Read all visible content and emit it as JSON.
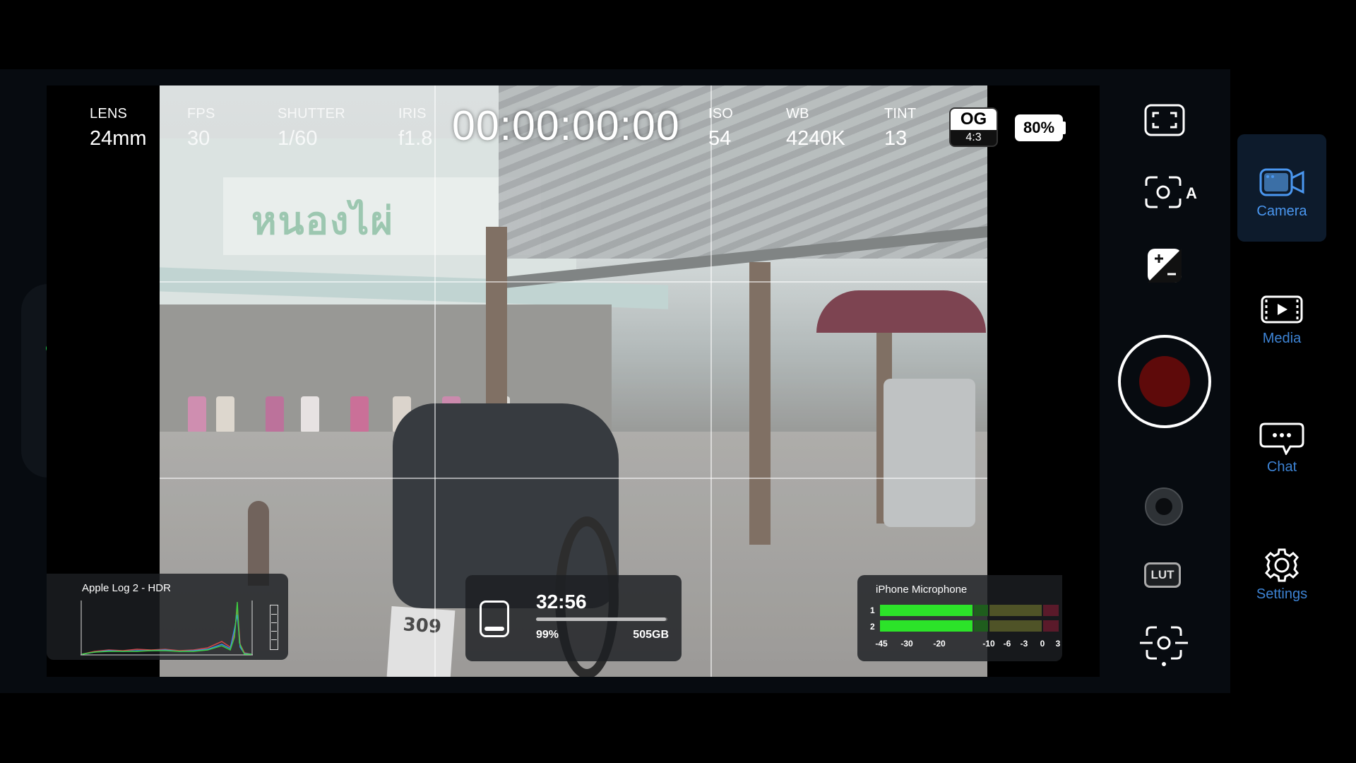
{
  "header": {
    "lens": {
      "label": "LENS",
      "value": "24mm"
    },
    "fps": {
      "label": "FPS",
      "value": "30"
    },
    "shutter": {
      "label": "SHUTTER",
      "value": "1/60"
    },
    "iris": {
      "label": "IRIS",
      "value": "f1.8"
    },
    "timecode": "00:00:00:00",
    "iso": {
      "label": "ISO",
      "value": "54"
    },
    "wb": {
      "label": "WB",
      "value": "4240K"
    },
    "tint": {
      "label": "TINT",
      "value": "13"
    },
    "aspect": {
      "format": "OG",
      "ratio": "4:3"
    },
    "battery": "80%"
  },
  "viewfinder": {
    "sign_text": "หนองไผ่",
    "plate_text": "309"
  },
  "histogram": {
    "title": "Apple Log 2 - HDR"
  },
  "storage": {
    "remaining_time": "32:56",
    "percent": "99%",
    "free_space": "505GB",
    "fill_fraction": 0.99
  },
  "audio": {
    "title": "iPhone Microphone",
    "channels": [
      {
        "label": "1",
        "level_db": -12
      },
      {
        "label": "2",
        "level_db": -12
      }
    ],
    "scale": [
      "-45",
      "-30",
      "-20",
      "-10",
      "-6",
      "-3",
      "0",
      "3"
    ]
  },
  "controls": {
    "icons": [
      "frame-guides-icon",
      "auto-exposure-icon",
      "exposure-compensation-icon",
      "record-button",
      "lens-select-icon",
      "lut-icon",
      "focus-icon"
    ],
    "lut_label": "LUT"
  },
  "tabs": [
    {
      "label": "Camera",
      "icon": "video-camera-icon",
      "active": true
    },
    {
      "label": "Media",
      "icon": "film-play-icon",
      "active": false
    },
    {
      "label": "Chat",
      "icon": "chat-bubble-icon",
      "active": false
    },
    {
      "label": "Settings",
      "icon": "gear-icon",
      "active": false
    }
  ],
  "colors": {
    "accent": "#4a97f0",
    "record": "#5e0a0a",
    "status_dot": "#1fc44a",
    "meter_green": "#2ce329"
  }
}
